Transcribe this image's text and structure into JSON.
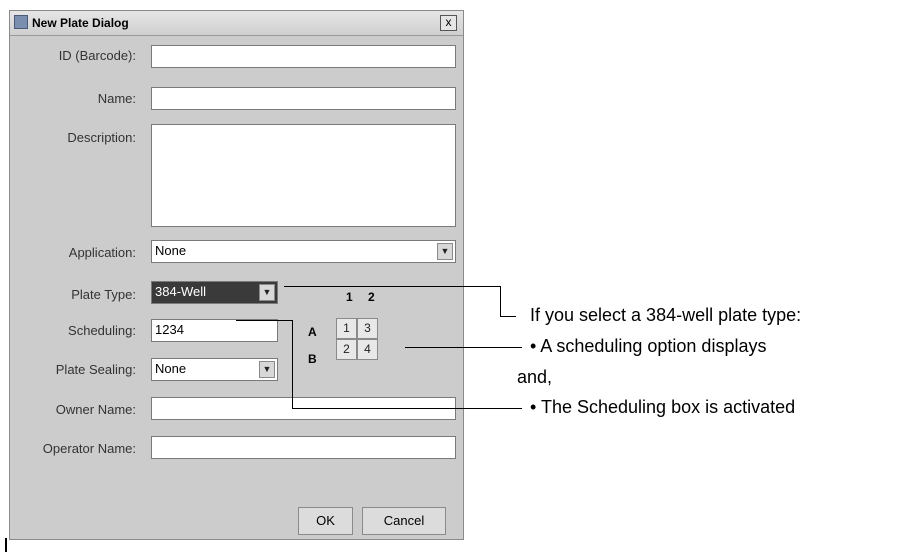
{
  "dialog": {
    "title": "New Plate Dialog",
    "close_symbol": "x",
    "labels": {
      "id": "ID (Barcode):",
      "name": "Name:",
      "description": "Description:",
      "application": "Application:",
      "plate_type": "Plate Type:",
      "scheduling": "Scheduling:",
      "plate_sealing": "Plate Sealing:",
      "owner_name": "Owner Name:",
      "operator_name": "Operator Name:"
    },
    "values": {
      "id": "",
      "name": "",
      "description": "",
      "application": "None",
      "plate_type": "384-Well",
      "scheduling": "1234",
      "plate_sealing": "None",
      "owner_name": "",
      "operator_name": ""
    },
    "scheduling_grid": {
      "columns": [
        "1",
        "2"
      ],
      "rows": [
        "A",
        "B"
      ],
      "cells": [
        [
          "1",
          "3"
        ],
        [
          "2",
          "4"
        ]
      ]
    },
    "buttons": {
      "ok": "OK",
      "cancel": "Cancel"
    }
  },
  "annotations": {
    "intro": "If you select a 384-well plate type:",
    "bullet1": "•  A scheduling option displays",
    "joiner": "and,",
    "bullet2": "•  The Scheduling box is activated"
  }
}
